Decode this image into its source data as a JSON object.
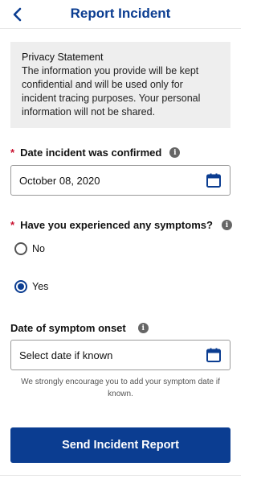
{
  "header": {
    "title": "Report Incident",
    "back_icon": "chevron-left-icon"
  },
  "privacy": {
    "title": "Privacy Statement",
    "body": "The information you provide will be kept confidential and will be used only for incident tracing purposes. Your personal information will not be shared."
  },
  "date_confirmed": {
    "required_marker": "*",
    "label": "Date incident was confirmed",
    "value": "October 08, 2020",
    "info_icon": "info-icon",
    "calendar_icon": "calendar-icon"
  },
  "symptoms": {
    "required_marker": "*",
    "label": "Have you experienced any symptoms?",
    "options": [
      {
        "label": "No",
        "selected": false
      },
      {
        "label": "Yes",
        "selected": true
      }
    ]
  },
  "symptom_onset": {
    "label": "Date of symptom onset",
    "placeholder": "Select date if known",
    "hint": "We strongly encourage you to add your symptom date if known."
  },
  "submit": {
    "label": "Send Incident Report"
  },
  "colors": {
    "primary": "#0b3d91",
    "required": "#c8102e",
    "privacy_bg": "#eeeeee"
  }
}
